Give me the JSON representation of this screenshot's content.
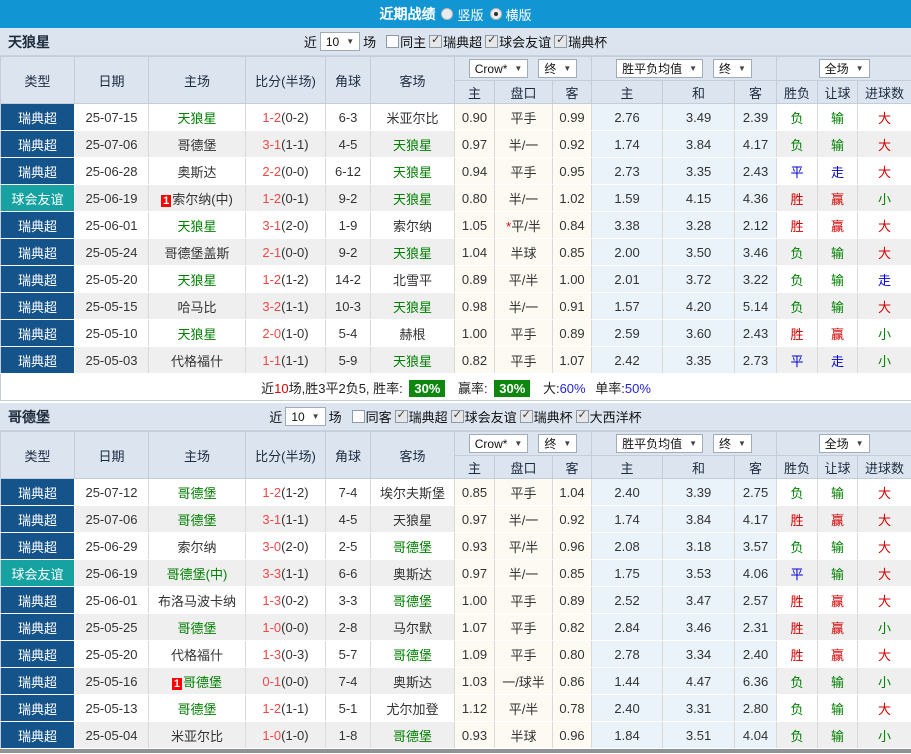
{
  "colors": {
    "titlebar_bg": "#1295d3",
    "league_cell_bg": "#15538b",
    "friendly_cell_bg": "#17a2a2",
    "header_bg": "#dce4ef",
    "row_alt_bg": "#efefef",
    "crow_columns_bg": "#fdfaf3",
    "mean_columns_bg": "#eaf3fa",
    "win_red": "#d40000",
    "lose_green": "#008000",
    "draw_blue": "#0000d8",
    "score_red": "#f44747",
    "focus_team_green": "#008000",
    "rate_badge_green": "#0d870d",
    "rate_value_blue": "#2323dd"
  },
  "title_bar": {
    "title": "近期战绩",
    "radios": [
      {
        "label": "竖版",
        "selected": false
      },
      {
        "label": "横版",
        "selected": true
      }
    ]
  },
  "sections": [
    {
      "team": "天狼星",
      "filters": {
        "near_label": "近",
        "games_count": "10",
        "games_label": "场",
        "same_venue": {
          "label": "同主",
          "checked": false
        },
        "competitions": [
          {
            "label": "瑞典超",
            "checked": true
          },
          {
            "label": "球会友谊",
            "checked": true
          },
          {
            "label": "瑞典杯",
            "checked": true
          }
        ]
      },
      "columns": {
        "type": "类型",
        "date": "日期",
        "home": "主场",
        "score": "比分(半场)",
        "corner": "角球",
        "away": "客场"
      },
      "selects": {
        "odds_company": "Crow*",
        "odds_final": "终",
        "mean": "胜平负均值",
        "mean_final": "终",
        "full": "全场"
      },
      "sub_columns": [
        "主",
        "盘口",
        "客",
        "主",
        "和",
        "客",
        "胜负",
        "让球",
        "进球数"
      ],
      "rows": [
        {
          "comp": "瑞典超",
          "date": "25-07-15",
          "home": "天狼星",
          "home_focus": true,
          "score_ft": "1-2",
          "score_ht": "(0-2)",
          "corner": "6-3",
          "away": "米亚尔比",
          "away_focus": false,
          "odds": [
            "0.90",
            "平手",
            "0.99"
          ],
          "mean": [
            "2.76",
            "3.49",
            "2.39"
          ],
          "results": [
            "负",
            "输",
            "大"
          ]
        },
        {
          "comp": "瑞典超",
          "date": "25-07-06",
          "home": "哥德堡",
          "home_focus": false,
          "score_ft": "3-1",
          "score_ht": "(1-1)",
          "corner": "4-5",
          "away": "天狼星",
          "away_focus": true,
          "odds": [
            "0.97",
            "半/一",
            "0.92"
          ],
          "mean": [
            "1.74",
            "3.84",
            "4.17"
          ],
          "results": [
            "负",
            "输",
            "大"
          ]
        },
        {
          "comp": "瑞典超",
          "date": "25-06-28",
          "home": "奥斯达",
          "home_focus": false,
          "score_ft": "2-2",
          "score_ht": "(0-0)",
          "corner": "6-12",
          "away": "天狼星",
          "away_focus": true,
          "odds": [
            "0.94",
            "平手",
            "0.95"
          ],
          "mean": [
            "2.73",
            "3.35",
            "2.43"
          ],
          "results": [
            "平",
            "走",
            "大"
          ]
        },
        {
          "comp": "球会友谊",
          "date": "25-06-19",
          "home": "索尔纳(中)",
          "home_focus": false,
          "home_badge": "1",
          "score_ft": "1-2",
          "score_ht": "(0-1)",
          "corner": "9-2",
          "away": "天狼星",
          "away_focus": true,
          "odds": [
            "0.80",
            "半/一",
            "1.02"
          ],
          "mean": [
            "1.59",
            "4.15",
            "4.36"
          ],
          "results": [
            "胜",
            "赢",
            "小"
          ]
        },
        {
          "comp": "瑞典超",
          "date": "25-06-01",
          "home": "天狼星",
          "home_focus": true,
          "score_ft": "3-1",
          "score_ht": "(2-0)",
          "corner": "1-9",
          "away": "索尔纳",
          "away_focus": false,
          "odds": [
            "1.05",
            "*平/半",
            "0.84"
          ],
          "mean": [
            "3.38",
            "3.28",
            "2.12"
          ],
          "results": [
            "胜",
            "赢",
            "大"
          ]
        },
        {
          "comp": "瑞典超",
          "date": "25-05-24",
          "home": "哥德堡盖斯",
          "home_focus": false,
          "score_ft": "2-1",
          "score_ht": "(0-0)",
          "corner": "9-2",
          "away": "天狼星",
          "away_focus": true,
          "odds": [
            "1.04",
            "半球",
            "0.85"
          ],
          "mean": [
            "2.00",
            "3.50",
            "3.46"
          ],
          "results": [
            "负",
            "输",
            "大"
          ]
        },
        {
          "comp": "瑞典超",
          "date": "25-05-20",
          "home": "天狼星",
          "home_focus": true,
          "score_ft": "1-2",
          "score_ht": "(1-2)",
          "corner": "14-2",
          "away": "北雪平",
          "away_focus": false,
          "odds": [
            "0.89",
            "平/半",
            "1.00"
          ],
          "mean": [
            "2.01",
            "3.72",
            "3.22"
          ],
          "results": [
            "负",
            "输",
            "走"
          ]
        },
        {
          "comp": "瑞典超",
          "date": "25-05-15",
          "home": "哈马比",
          "home_focus": false,
          "score_ft": "3-2",
          "score_ht": "(1-1)",
          "corner": "10-3",
          "away": "天狼星",
          "away_focus": true,
          "odds": [
            "0.98",
            "半/一",
            "0.91"
          ],
          "mean": [
            "1.57",
            "4.20",
            "5.14"
          ],
          "results": [
            "负",
            "输",
            "大"
          ]
        },
        {
          "comp": "瑞典超",
          "date": "25-05-10",
          "home": "天狼星",
          "home_focus": true,
          "score_ft": "2-0",
          "score_ht": "(1-0)",
          "corner": "5-4",
          "away": "赫根",
          "away_focus": false,
          "odds": [
            "1.00",
            "平手",
            "0.89"
          ],
          "mean": [
            "2.59",
            "3.60",
            "2.43"
          ],
          "results": [
            "胜",
            "赢",
            "小"
          ]
        },
        {
          "comp": "瑞典超",
          "date": "25-05-03",
          "home": "代格福什",
          "home_focus": false,
          "score_ft": "1-1",
          "score_ht": "(1-1)",
          "corner": "5-9",
          "away": "天狼星",
          "away_focus": true,
          "odds": [
            "0.82",
            "平手",
            "1.07"
          ],
          "mean": [
            "2.42",
            "3.35",
            "2.73"
          ],
          "results": [
            "平",
            "走",
            "小"
          ]
        }
      ],
      "summary": {
        "near_label": "近",
        "count": "10",
        "record": "场,胜3平2负5, 胜率:",
        "win_rate": "30%",
        "handicap_label": "赢率:",
        "handicap_rate": "30%",
        "big_label": "大:",
        "big_rate": "60%",
        "odd_label": "单率:",
        "odd_rate": "50%"
      }
    },
    {
      "team": "哥德堡",
      "filters": {
        "near_label": "近",
        "games_count": "10",
        "games_label": "场",
        "same_venue": {
          "label": "同客",
          "checked": false
        },
        "competitions": [
          {
            "label": "瑞典超",
            "checked": true
          },
          {
            "label": "球会友谊",
            "checked": true
          },
          {
            "label": "瑞典杯",
            "checked": true
          },
          {
            "label": "大西洋杯",
            "checked": true
          }
        ]
      },
      "columns": {
        "type": "类型",
        "date": "日期",
        "home": "主场",
        "score": "比分(半场)",
        "corner": "角球",
        "away": "客场"
      },
      "selects": {
        "odds_company": "Crow*",
        "odds_final": "终",
        "mean": "胜平负均值",
        "mean_final": "终",
        "full": "全场"
      },
      "sub_columns": [
        "主",
        "盘口",
        "客",
        "主",
        "和",
        "客",
        "胜负",
        "让球",
        "进球数"
      ],
      "rows": [
        {
          "comp": "瑞典超",
          "date": "25-07-12",
          "home": "哥德堡",
          "home_focus": true,
          "score_ft": "1-2",
          "score_ht": "(1-2)",
          "corner": "7-4",
          "away": "埃尔夫斯堡",
          "away_focus": false,
          "odds": [
            "0.85",
            "平手",
            "1.04"
          ],
          "mean": [
            "2.40",
            "3.39",
            "2.75"
          ],
          "results": [
            "负",
            "输",
            "大"
          ]
        },
        {
          "comp": "瑞典超",
          "date": "25-07-06",
          "home": "哥德堡",
          "home_focus": true,
          "score_ft": "3-1",
          "score_ht": "(1-1)",
          "corner": "4-5",
          "away": "天狼星",
          "away_focus": false,
          "odds": [
            "0.97",
            "半/一",
            "0.92"
          ],
          "mean": [
            "1.74",
            "3.84",
            "4.17"
          ],
          "results": [
            "胜",
            "赢",
            "大"
          ]
        },
        {
          "comp": "瑞典超",
          "date": "25-06-29",
          "home": "索尔纳",
          "home_focus": false,
          "score_ft": "3-0",
          "score_ht": "(2-0)",
          "corner": "2-5",
          "away": "哥德堡",
          "away_focus": true,
          "odds": [
            "0.93",
            "平/半",
            "0.96"
          ],
          "mean": [
            "2.08",
            "3.18",
            "3.57"
          ],
          "results": [
            "负",
            "输",
            "大"
          ]
        },
        {
          "comp": "球会友谊",
          "date": "25-06-19",
          "home": "哥德堡(中)",
          "home_focus": true,
          "score_ft": "3-3",
          "score_ht": "(1-1)",
          "corner": "6-6",
          "away": "奥斯达",
          "away_focus": false,
          "odds": [
            "0.97",
            "半/一",
            "0.85"
          ],
          "mean": [
            "1.75",
            "3.53",
            "4.06"
          ],
          "results": [
            "平",
            "输",
            "大"
          ]
        },
        {
          "comp": "瑞典超",
          "date": "25-06-01",
          "home": "布洛马波卡纳",
          "home_focus": false,
          "score_ft": "1-3",
          "score_ht": "(0-2)",
          "corner": "3-3",
          "away": "哥德堡",
          "away_focus": true,
          "odds": [
            "1.00",
            "平手",
            "0.89"
          ],
          "mean": [
            "2.52",
            "3.47",
            "2.57"
          ],
          "results": [
            "胜",
            "赢",
            "大"
          ]
        },
        {
          "comp": "瑞典超",
          "date": "25-05-25",
          "home": "哥德堡",
          "home_focus": true,
          "score_ft": "1-0",
          "score_ht": "(0-0)",
          "corner": "2-8",
          "away": "马尔默",
          "away_focus": false,
          "odds": [
            "1.07",
            "平手",
            "0.82"
          ],
          "mean": [
            "2.84",
            "3.46",
            "2.31"
          ],
          "results": [
            "胜",
            "赢",
            "小"
          ]
        },
        {
          "comp": "瑞典超",
          "date": "25-05-20",
          "home": "代格福什",
          "home_focus": false,
          "score_ft": "1-3",
          "score_ht": "(0-3)",
          "corner": "5-7",
          "away": "哥德堡",
          "away_focus": true,
          "odds": [
            "1.09",
            "平手",
            "0.80"
          ],
          "mean": [
            "2.78",
            "3.34",
            "2.40"
          ],
          "results": [
            "胜",
            "赢",
            "大"
          ]
        },
        {
          "comp": "瑞典超",
          "date": "25-05-16",
          "home": "哥德堡",
          "home_focus": true,
          "home_badge": "1",
          "score_ft": "0-1",
          "score_ht": "(0-0)",
          "corner": "7-4",
          "away": "奥斯达",
          "away_focus": false,
          "odds": [
            "1.03",
            "一/球半",
            "0.86"
          ],
          "mean": [
            "1.44",
            "4.47",
            "6.36"
          ],
          "results": [
            "负",
            "输",
            "小"
          ]
        },
        {
          "comp": "瑞典超",
          "date": "25-05-13",
          "home": "哥德堡",
          "home_focus": true,
          "score_ft": "1-2",
          "score_ht": "(1-1)",
          "corner": "5-1",
          "away": "尤尔加登",
          "away_focus": false,
          "odds": [
            "1.12",
            "平/半",
            "0.78"
          ],
          "mean": [
            "2.40",
            "3.31",
            "2.80"
          ],
          "results": [
            "负",
            "输",
            "大"
          ]
        },
        {
          "comp": "瑞典超",
          "date": "25-05-04",
          "home": "米亚尔比",
          "home_focus": false,
          "score_ft": "1-0",
          "score_ht": "(1-0)",
          "corner": "1-8",
          "away": "哥德堡",
          "away_focus": true,
          "odds": [
            "0.93",
            "半球",
            "0.96"
          ],
          "mean": [
            "1.84",
            "3.51",
            "4.04"
          ],
          "results": [
            "负",
            "输",
            "小"
          ]
        }
      ],
      "summary": null
    }
  ]
}
